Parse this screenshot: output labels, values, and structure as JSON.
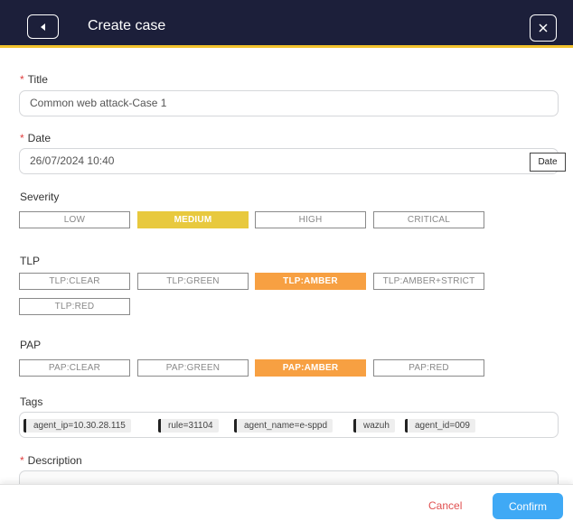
{
  "header": {
    "title": "Create case",
    "back_icon": "chevron-left-icon",
    "close_icon": "close-icon"
  },
  "title_field": {
    "label": "Title",
    "required": "*",
    "value": "Common web attack-Case 1"
  },
  "date_field": {
    "label": "Date",
    "required": "*",
    "value": "26/07/2024 10:40",
    "button_label": "Date"
  },
  "severity": {
    "label": "Severity",
    "options": [
      "LOW",
      "MEDIUM",
      "HIGH",
      "CRITICAL"
    ],
    "selected": "MEDIUM"
  },
  "tlp": {
    "label": "TLP",
    "options": [
      "TLP:CLEAR",
      "TLP:GREEN",
      "TLP:AMBER",
      "TLP:AMBER+STRICT",
      "TLP:RED"
    ],
    "selected": "TLP:AMBER"
  },
  "pap": {
    "label": "PAP",
    "options": [
      "PAP:CLEAR",
      "PAP:GREEN",
      "PAP:AMBER",
      "PAP:RED"
    ],
    "selected": "PAP:AMBER"
  },
  "tags": {
    "label": "Tags",
    "items": [
      "agent_ip=10.30.28.115",
      "rule=31104",
      "agent_name=e-sppd",
      "wazuh",
      "agent_id=009"
    ]
  },
  "description": {
    "label": "Description",
    "required": "*"
  },
  "footer": {
    "cancel_label": "Cancel",
    "confirm_label": "Confirm"
  },
  "colors": {
    "header_bg": "#1c1f3a",
    "header_accent": "#f2c22c",
    "severity_selected": "#e8c93e",
    "amber_selected": "#f7a042",
    "confirm_bg": "#3fa9f5",
    "cancel_text": "#e05050",
    "required_mark": "#e04040"
  }
}
